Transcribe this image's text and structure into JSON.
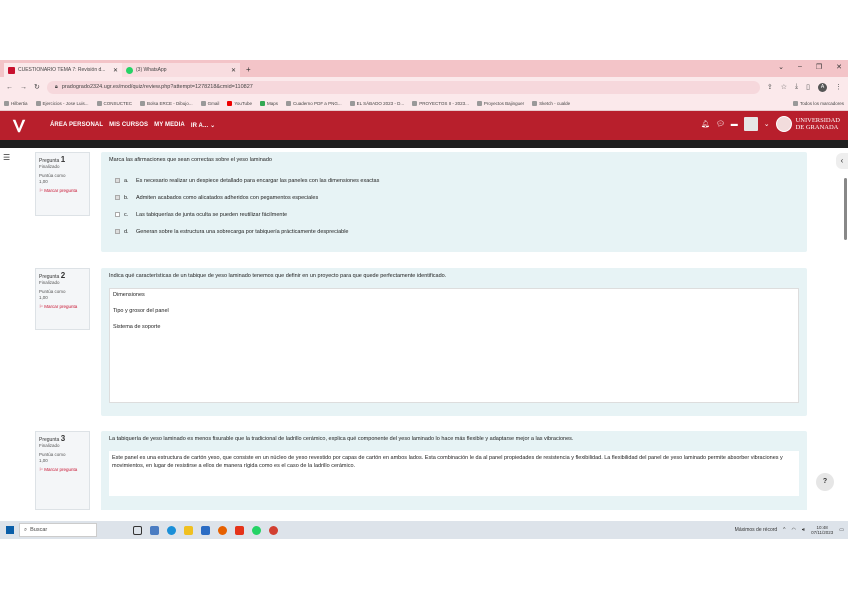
{
  "browser": {
    "tabs": [
      {
        "label": "CUESTIONARIO TEMA 7: Revisión d...",
        "active": true,
        "favicon_color": "#c8102e"
      },
      {
        "label": "(3) WhatsApp",
        "active": false,
        "favicon_color": "#25d366"
      }
    ],
    "new_tab": "+",
    "url": "pradogrado2324.ugr.es/mod/quiz/review.php?attempt=1278218&cmid=110827",
    "profile_initial": "A",
    "bookmarks": [
      "Hilbertia",
      "Ejercicios - Jose Luis...",
      "CONSUCTEC",
      "Bolsa ERCE - Dibujo...",
      "Gmail",
      "YouTube",
      "Maps",
      "Cuaderno PDF a PNG...",
      "EL SÁBADO 2023 - D...",
      "PROYECTOS II - 2023...",
      "Proyectos Bajinguer",
      "Sketch - cualde",
      "Todos los marcadores"
    ]
  },
  "navbar": {
    "links": [
      "ÁREA PERSONAL",
      "MIS CURSOS",
      "MY MEDIA",
      "IR A..."
    ],
    "university_line1": "UNIVERSIDAD",
    "university_line2": "DE GRANADA"
  },
  "questions": [
    {
      "label": "Pregunta",
      "number": "1",
      "status": "Finalizado",
      "score_label": "Puntúa como",
      "score": "1,00",
      "flag": "Marcar pregunta",
      "text": "Marca las afirmaciones que sean correctas sobre el yeso laminado",
      "options": [
        {
          "letter": "a.",
          "text": "Es necesario realizar un despiece detallado para encargar las paneles con las dimensiones exactas"
        },
        {
          "letter": "b.",
          "text": "Admiten acabados como alicatados adheridos con pegamentos especiales"
        },
        {
          "letter": "c.",
          "text": "Las tabiquerías de junta oculta se pueden reutilizar fácilmente"
        },
        {
          "letter": "d.",
          "text": "Generan sobre la estructura una sobrecarga por tabiquería prácticamente despreciable"
        }
      ]
    },
    {
      "label": "Pregunta",
      "number": "2",
      "status": "Finalizado",
      "score_label": "Puntúa como",
      "score": "1,00",
      "flag": "Marcar pregunta",
      "text": "Indica qué características de un tabique de yeso laminado tenemos que definir en un proyecto para que quede perfectamente identificado.",
      "answer_lines": [
        "Dimensiones",
        "Tipo y grosor del panel",
        "Sistema de soporte"
      ]
    },
    {
      "label": "Pregunta",
      "number": "3",
      "status": "Finalizado",
      "score_label": "Puntúa como",
      "score": "1,00",
      "flag": "Marcar pregunta",
      "text": "La tabiquería de yeso laminado es menos fisurable que la tradicional de ladrillo cerámico, explica qué componente del yeso laminado lo hace más flexible y adaptarse mejor a las vibraciones.",
      "answer": "Este panel es una estructura de cartón yeso, que consiste en un núcleo de yeso revestido por capas de cartón en ambos lados. Esta combinación le da al panel propiedades de resistencia y flexibilidad. La flexibilidad del panel de yeso laminado permite absorber vibraciones y movimientos, en lugar de resistirse a ellos de manera rígida como es el caso de la ladrillo cerámico."
    }
  ],
  "help_label": "?",
  "taskbar": {
    "search_placeholder": "Buscar",
    "notification": "Máximos de récord",
    "time": "10:48",
    "date": "07/11/2023"
  }
}
